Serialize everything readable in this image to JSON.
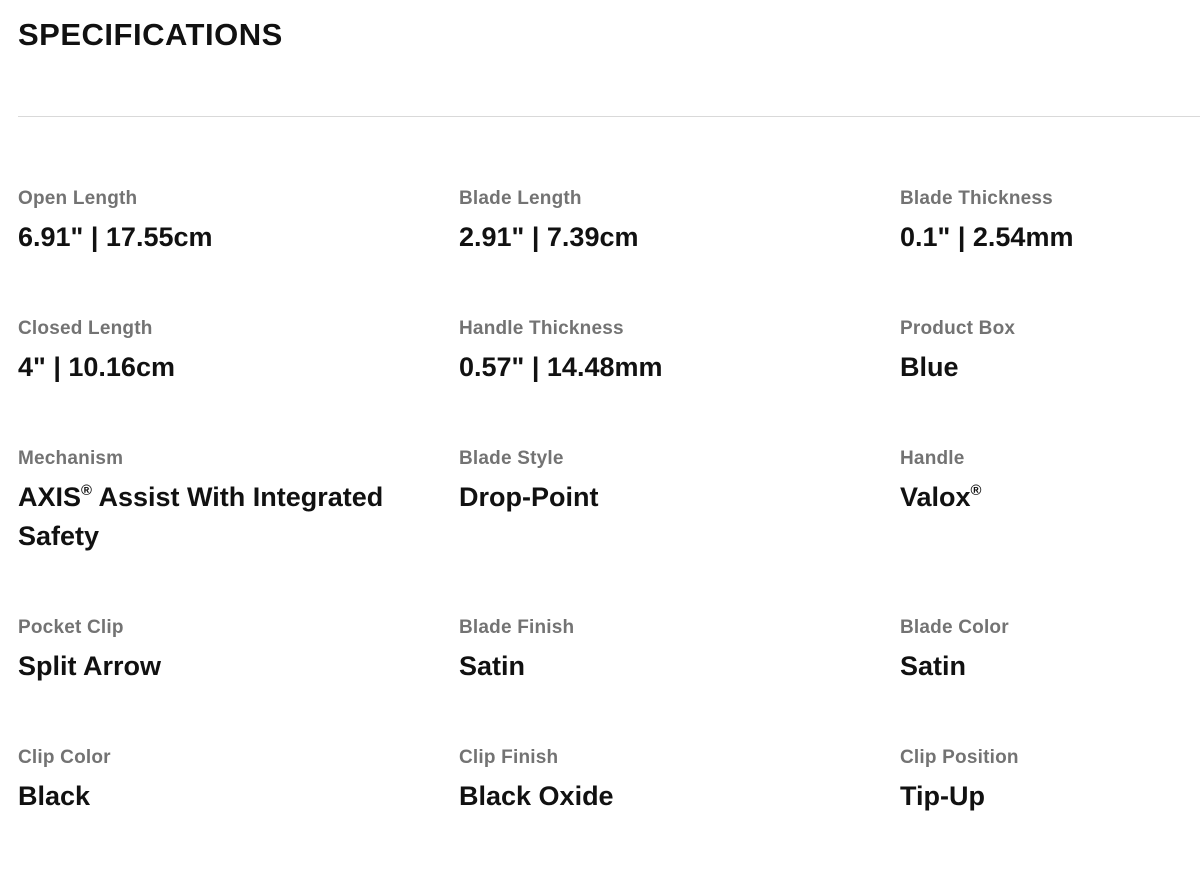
{
  "page": {
    "title": "SPECIFICATIONS"
  },
  "specs": [
    [
      {
        "label": "Open Length",
        "value": "6.91\" | 17.55cm"
      },
      {
        "label": "Blade Length",
        "value": "2.91\" | 7.39cm"
      },
      {
        "label": "Blade Thickness",
        "value": "0.1\" | 2.54mm"
      }
    ],
    [
      {
        "label": "Closed Length",
        "value": "4\" | 10.16cm"
      },
      {
        "label": "Handle Thickness",
        "value": "0.57\" | 14.48mm"
      },
      {
        "label": "Product Box",
        "value": "Blue"
      }
    ],
    [
      {
        "label": "Mechanism",
        "value_main": "AXIS",
        "value_mark": "®",
        "value_rest": " Assist With Integrated Safety"
      },
      {
        "label": "Blade Style",
        "value": "Drop-Point"
      },
      {
        "label": "Handle",
        "value_main": "Valox",
        "value_mark": "®",
        "value_rest": ""
      }
    ],
    [
      {
        "label": "Pocket Clip",
        "value": "Split Arrow"
      },
      {
        "label": "Blade Finish",
        "value": "Satin"
      },
      {
        "label": "Blade Color",
        "value": "Satin"
      }
    ],
    [
      {
        "label": "Clip Color",
        "value": "Black"
      },
      {
        "label": "Clip Finish",
        "value": "Black Oxide"
      },
      {
        "label": "Clip Position",
        "value": "Tip-Up"
      }
    ]
  ]
}
